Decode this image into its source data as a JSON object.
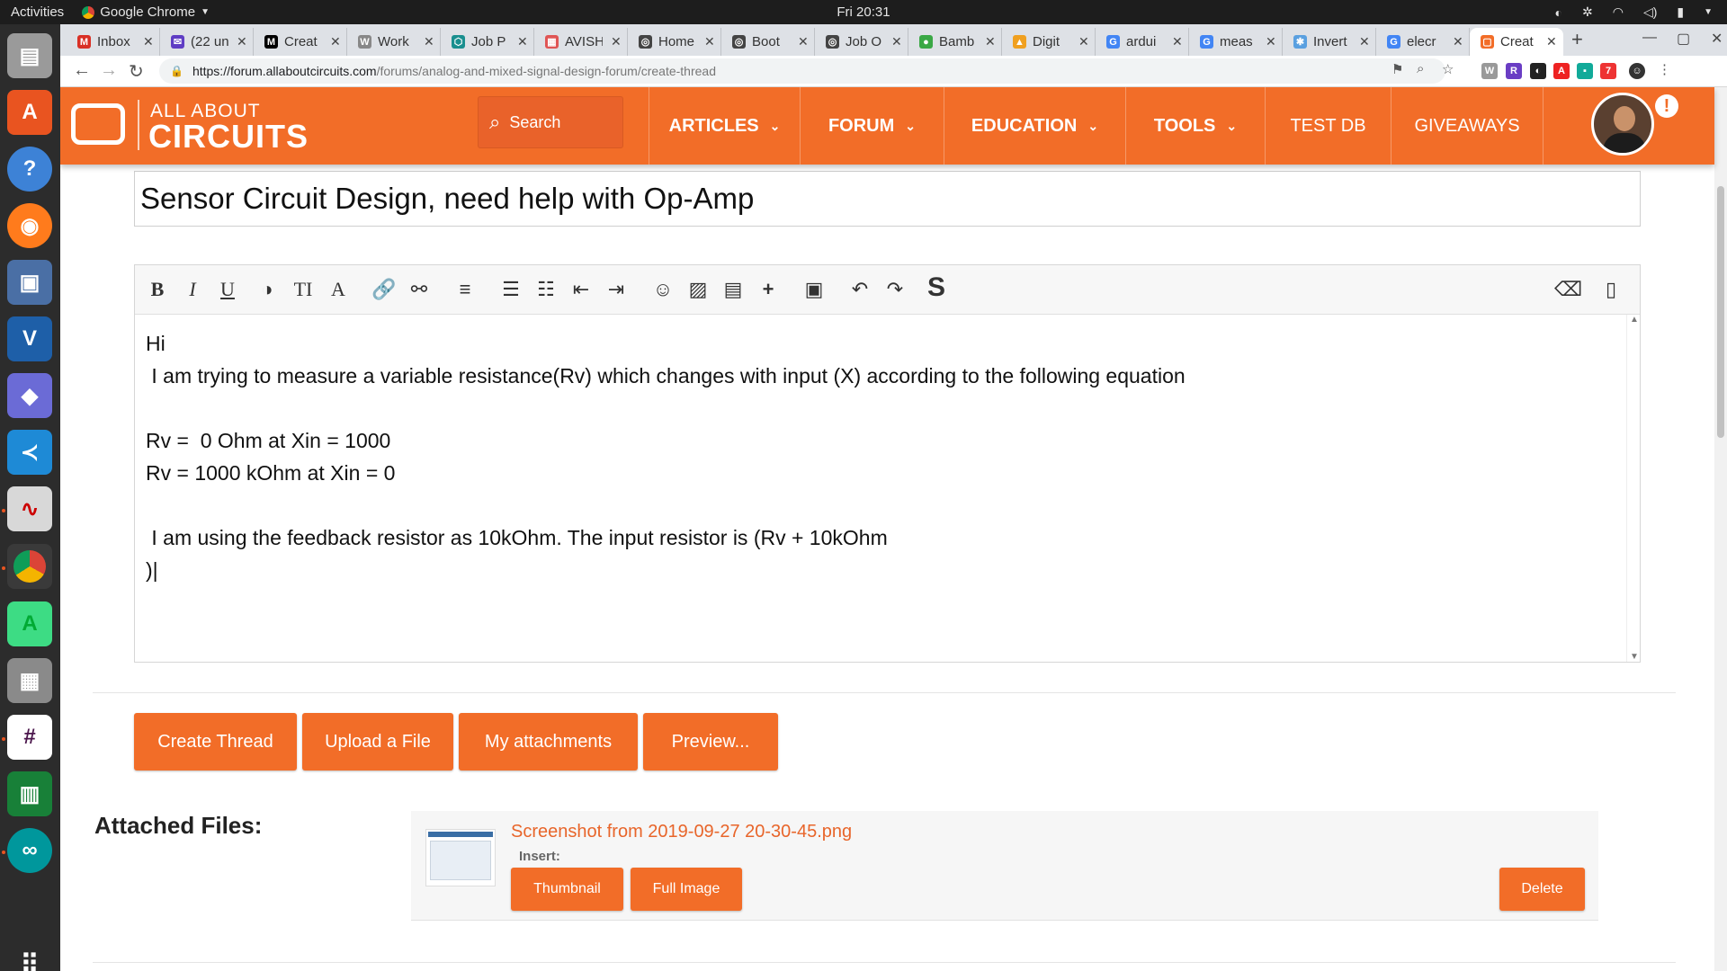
{
  "os": {
    "activities": "Activities",
    "app_name": "Google Chrome",
    "clock": "Fri 20:31"
  },
  "browser": {
    "tabs": [
      {
        "label": "Inbox",
        "fav": "M",
        "fav_color": "#d93025"
      },
      {
        "label": "(22 un",
        "fav": "✉",
        "fav_color": "#5f3dc4"
      },
      {
        "label": "Creat",
        "fav": "M",
        "fav_color": "#000000"
      },
      {
        "label": "Work",
        "fav": "W",
        "fav_color": "#888888"
      },
      {
        "label": "Job P",
        "fav": "⬡",
        "fav_color": "#1a8f8f"
      },
      {
        "label": "AVISH",
        "fav": "▦",
        "fav_color": "#e05555"
      },
      {
        "label": "Home",
        "fav": "◎",
        "fav_color": "#444444"
      },
      {
        "label": "Boot",
        "fav": "◎",
        "fav_color": "#444444"
      },
      {
        "label": "Job O",
        "fav": "◎",
        "fav_color": "#444444"
      },
      {
        "label": "Bamb",
        "fav": "●",
        "fav_color": "#3aa845"
      },
      {
        "label": "Digit",
        "fav": "▲",
        "fav_color": "#f0a020"
      },
      {
        "label": "ardui",
        "fav": "G",
        "fav_color": "#4285f4"
      },
      {
        "label": "meas",
        "fav": "G",
        "fav_color": "#4285f4"
      },
      {
        "label": "Invert",
        "fav": "✱",
        "fav_color": "#5aa0e0"
      },
      {
        "label": "elecr",
        "fav": "G",
        "fav_color": "#4285f4"
      },
      {
        "label": "Creat",
        "fav": "▢",
        "fav_color": "#f26d28"
      }
    ],
    "url_host": "https://forum.allaboutcircuits.com",
    "url_path": "/forums/analog-and-mixed-signal-design-forum/create-thread"
  },
  "site": {
    "logo_top": "ALL ABOUT",
    "logo_bottom": "CIRCUITS",
    "search_placeholder": "Search",
    "nav": [
      {
        "label": "ARTICLES"
      },
      {
        "label": "FORUM"
      },
      {
        "label": "EDUCATION"
      },
      {
        "label": "TOOLS"
      },
      {
        "label": "TEST DB"
      },
      {
        "label": "GIVEAWAYS"
      }
    ],
    "alert": "!"
  },
  "thread": {
    "title": "Sensor Circuit Design, need help with Op-Amp",
    "body_lines": [
      "Hi",
      " I am trying to measure a variable resistance(Rv) which changes with input (X) according to the following equation",
      "",
      "Rv =  0 Ohm at Xin = 1000",
      "Rv = 1000 kOhm at Xin = 0",
      "",
      " I am using the feedback resistor as 10kOhm. The input resistor is (Rv + 10kOhm",
      ")|"
    ]
  },
  "actions": {
    "create": "Create Thread",
    "upload": "Upload a File",
    "attachments": "My attachments",
    "preview": "Preview..."
  },
  "attached": {
    "heading": "Attached Files:",
    "filename": "Screenshot from 2019-09-27 20-30-45.png",
    "insert_label": "Insert:",
    "thumbnail": "Thumbnail",
    "full_image": "Full Image",
    "delete": "Delete"
  },
  "colors": {
    "brand": "#f26d28",
    "link": "#e8652a"
  }
}
